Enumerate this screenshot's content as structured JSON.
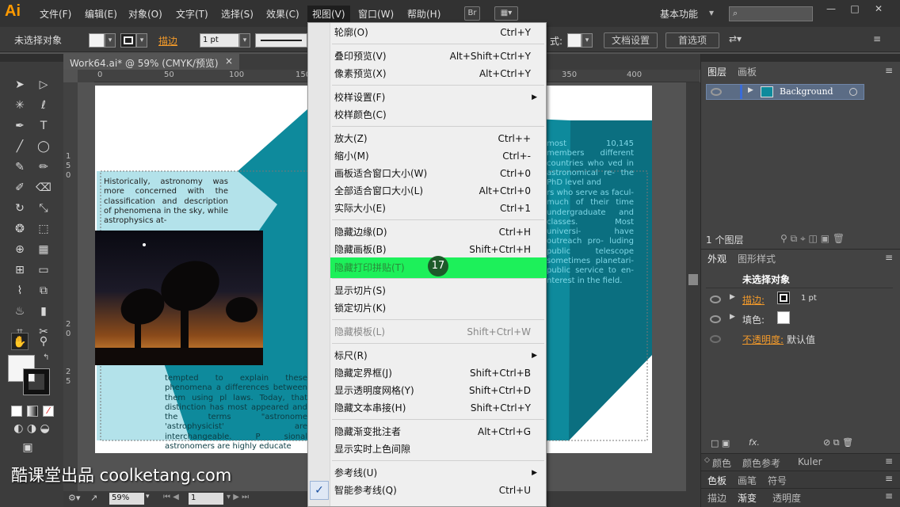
{
  "app_logo": "Ai",
  "menubar": {
    "items": [
      "文件(F)",
      "编辑(E)",
      "对象(O)",
      "文字(T)",
      "选择(S)",
      "效果(C)",
      "视图(V)",
      "窗口(W)",
      "帮助(H)"
    ],
    "bridge_button": "Br",
    "workspace": "基本功能"
  },
  "controlbar": {
    "selection": "未选择对象",
    "stroke_label": "描边",
    "stroke_value": "1 pt",
    "style_label": "式:",
    "doc_setup": "文档设置",
    "preferences": "首选项"
  },
  "document": {
    "tab_title": "Work64.ai* @ 59% (CMYK/预览)",
    "close": "×",
    "zoom": "59%",
    "artboard_nav": "1"
  },
  "ruler": {
    "h_labels": [
      "0",
      "50",
      "100",
      "150",
      "350",
      "400"
    ],
    "v_labels": [
      "1",
      "5",
      "0",
      "2",
      "0",
      "2",
      "5"
    ]
  },
  "artwork": {
    "left_text_top": "Historically, astronomy was more concerned with the classification and description of phenomena in the sky, while astrophysics at-",
    "left_text_bottom": "tempted to explain these phenomena a differences between them using pl laws. Today, that distinction has most appeared and the terms \"astronome 'astrophysicist' are interchangeable. P sional astronomers are highly educate",
    "right_text_1": "most 10,145 members different countries who ved in astronomical re- the PhD level and",
    "right_text_2": "rs who serve as facul- much of their time undergraduate and classes. Most universi- have outreach pro- luding public telescope sometimes planetari- public service to en- nterest in the field."
  },
  "view_menu": {
    "items": [
      {
        "label": "轮廓(O)",
        "shortcut": "Ctrl+Y"
      },
      {
        "label": "叠印预览(V)",
        "shortcut": "Alt+Shift+Ctrl+Y"
      },
      {
        "label": "像素预览(X)",
        "shortcut": "Alt+Ctrl+Y"
      },
      {
        "label": "校样设置(F)",
        "shortcut": ""
      },
      {
        "label": "校样颜色(C)",
        "shortcut": ""
      },
      {
        "label": "放大(Z)",
        "shortcut": "Ctrl++"
      },
      {
        "label": "缩小(M)",
        "shortcut": "Ctrl+-"
      },
      {
        "label": "画板适合窗口大小(W)",
        "shortcut": "Ctrl+0"
      },
      {
        "label": "全部适合窗口大小(L)",
        "shortcut": "Alt+Ctrl+0"
      },
      {
        "label": "实际大小(E)",
        "shortcut": "Ctrl+1"
      },
      {
        "label": "隐藏边缘(D)",
        "shortcut": "Ctrl+H"
      },
      {
        "label": "隐藏画板(B)",
        "shortcut": "Shift+Ctrl+H"
      },
      {
        "label": "隐藏打印拼贴(T)",
        "shortcut": ""
      },
      {
        "label": "显示切片(S)",
        "shortcut": ""
      },
      {
        "label": "锁定切片(K)",
        "shortcut": ""
      },
      {
        "label": "隐藏模板(L)",
        "shortcut": "Shift+Ctrl+W"
      },
      {
        "label": "标尺(R)",
        "shortcut": ""
      },
      {
        "label": "隐藏定界框(J)",
        "shortcut": "Shift+Ctrl+B"
      },
      {
        "label": "显示透明度网格(Y)",
        "shortcut": "Shift+Ctrl+D"
      },
      {
        "label": "隐藏文本串接(H)",
        "shortcut": "Shift+Ctrl+Y"
      },
      {
        "label": "隐藏渐变批注者",
        "shortcut": "Alt+Ctrl+G"
      },
      {
        "label": "显示实时上色间隙",
        "shortcut": ""
      },
      {
        "label": "参考线(U)",
        "shortcut": ""
      },
      {
        "label": "智能参考线(Q)",
        "shortcut": "Ctrl+U"
      }
    ],
    "checkmark": "✓",
    "step_badge": "17"
  },
  "layers_panel": {
    "tab_layers": "图层",
    "tab_artboards": "画板",
    "layer_name": "Background",
    "count": "1 个图层"
  },
  "appearance_panel": {
    "tab_appearance": "外观",
    "tab_graphic_styles": "图形样式",
    "title": "未选择对象",
    "stroke_label": "描边:",
    "stroke_value": "1 pt",
    "fill_label": "填色:",
    "opacity_label": "不透明度:",
    "opacity_value": "默认值",
    "fx": "fx."
  },
  "bottom_panels": {
    "row1": [
      "颜色",
      "颜色参考",
      "Kuler"
    ],
    "row2": [
      "色板",
      "画笔",
      "符号"
    ],
    "row3": [
      "描边",
      "渐变",
      "透明度"
    ]
  },
  "watermark": "酷课堂出品 coolketang.com",
  "colors": {
    "highlight": "#1df05a",
    "teal": "#0e7f93",
    "light_teal": "#b3e2ea",
    "ai_orange": "#ff9a00"
  }
}
